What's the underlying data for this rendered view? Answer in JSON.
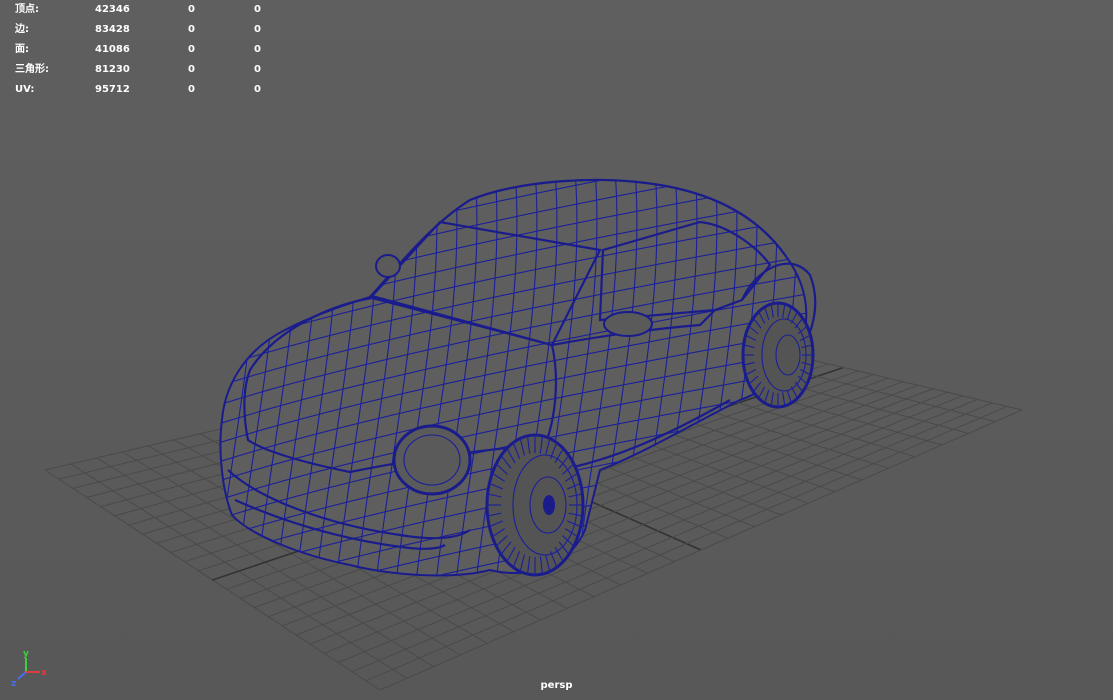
{
  "hud": {
    "rows": [
      {
        "label": "顶点:",
        "v1": "42346",
        "v2": "0",
        "v3": "0"
      },
      {
        "label": "边:",
        "v1": "83428",
        "v2": "0",
        "v3": "0"
      },
      {
        "label": "面:",
        "v1": "41086",
        "v2": "0",
        "v3": "0"
      },
      {
        "label": "三角形:",
        "v1": "81230",
        "v2": "0",
        "v3": "0"
      },
      {
        "label": "UV:",
        "v1": "95712",
        "v2": "0",
        "v3": "0"
      }
    ]
  },
  "axis_gizmo": {
    "x_label": "x",
    "y_label": "y",
    "z_label": "z",
    "x_color": "#e23b3b",
    "y_color": "#3bd13b",
    "z_color": "#4a6cf0"
  },
  "camera": {
    "name": "persp"
  },
  "colors": {
    "background": "#5c5c5c",
    "wireframe": "#1a1f9a",
    "grid": "#4a4a4a"
  }
}
